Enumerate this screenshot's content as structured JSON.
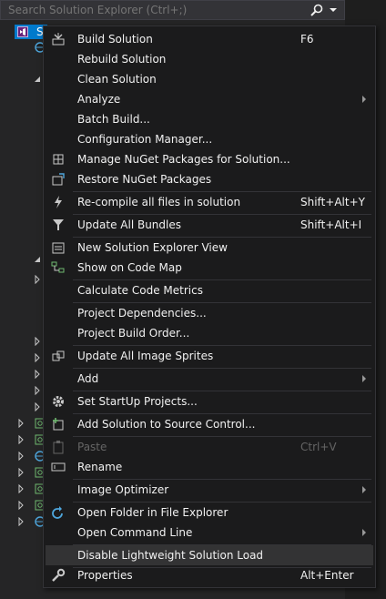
{
  "search": {
    "placeholder": "Search Solution Explorer (Ctrl+;)"
  },
  "tree": {
    "selected_label": "S"
  },
  "menu": {
    "items": [
      {
        "label": "Build Solution",
        "shortcut": "F6",
        "icon": "build-icon"
      },
      {
        "label": "Rebuild Solution",
        "shortcut": ""
      },
      {
        "label": "Clean Solution",
        "shortcut": ""
      },
      {
        "label": "Analyze",
        "shortcut": "",
        "submenu": true
      },
      {
        "label": "Batch Build...",
        "shortcut": ""
      },
      {
        "label": "Configuration Manager...",
        "shortcut": ""
      },
      {
        "label": "Manage NuGet Packages for Solution...",
        "shortcut": "",
        "icon": "nuget-icon"
      },
      {
        "label": "Restore NuGet Packages",
        "shortcut": "",
        "icon": "restore-icon"
      },
      {
        "label": "Re-compile all files in solution",
        "shortcut": "Shift+Alt+Y",
        "icon": "lightning-icon"
      },
      {
        "label": "Update All Bundles",
        "shortcut": "Shift+Alt+I",
        "icon": "filter-icon"
      },
      {
        "label": "New Solution Explorer View",
        "shortcut": "",
        "icon": "new-view-icon"
      },
      {
        "label": "Show on Code Map",
        "shortcut": "",
        "icon": "code-map-icon"
      },
      {
        "label": "Calculate Code Metrics",
        "shortcut": ""
      },
      {
        "label": "Project Dependencies...",
        "shortcut": ""
      },
      {
        "label": "Project Build Order...",
        "shortcut": ""
      },
      {
        "label": "Update All Image Sprites",
        "shortcut": "",
        "icon": "sprites-icon"
      },
      {
        "label": "Add",
        "shortcut": "",
        "submenu": true
      },
      {
        "label": "Set StartUp Projects...",
        "shortcut": "",
        "icon": "gear-icon"
      },
      {
        "label": "Add Solution to Source Control...",
        "shortcut": "",
        "icon": "source-control-icon"
      },
      {
        "label": "Paste",
        "shortcut": "Ctrl+V",
        "icon": "paste-icon",
        "disabled": true
      },
      {
        "label": "Rename",
        "shortcut": "",
        "icon": "rename-icon"
      },
      {
        "label": "Image Optimizer",
        "shortcut": "",
        "submenu": true
      },
      {
        "label": "Open Folder in File Explorer",
        "shortcut": "",
        "icon": "open-folder-icon"
      },
      {
        "label": "Open Command Line",
        "shortcut": "",
        "submenu": true
      },
      {
        "label": "Disable Lightweight Solution Load",
        "shortcut": "",
        "highlighted": true
      },
      {
        "label": "Properties",
        "shortcut": "Alt+Enter",
        "icon": "wrench-icon"
      }
    ]
  }
}
